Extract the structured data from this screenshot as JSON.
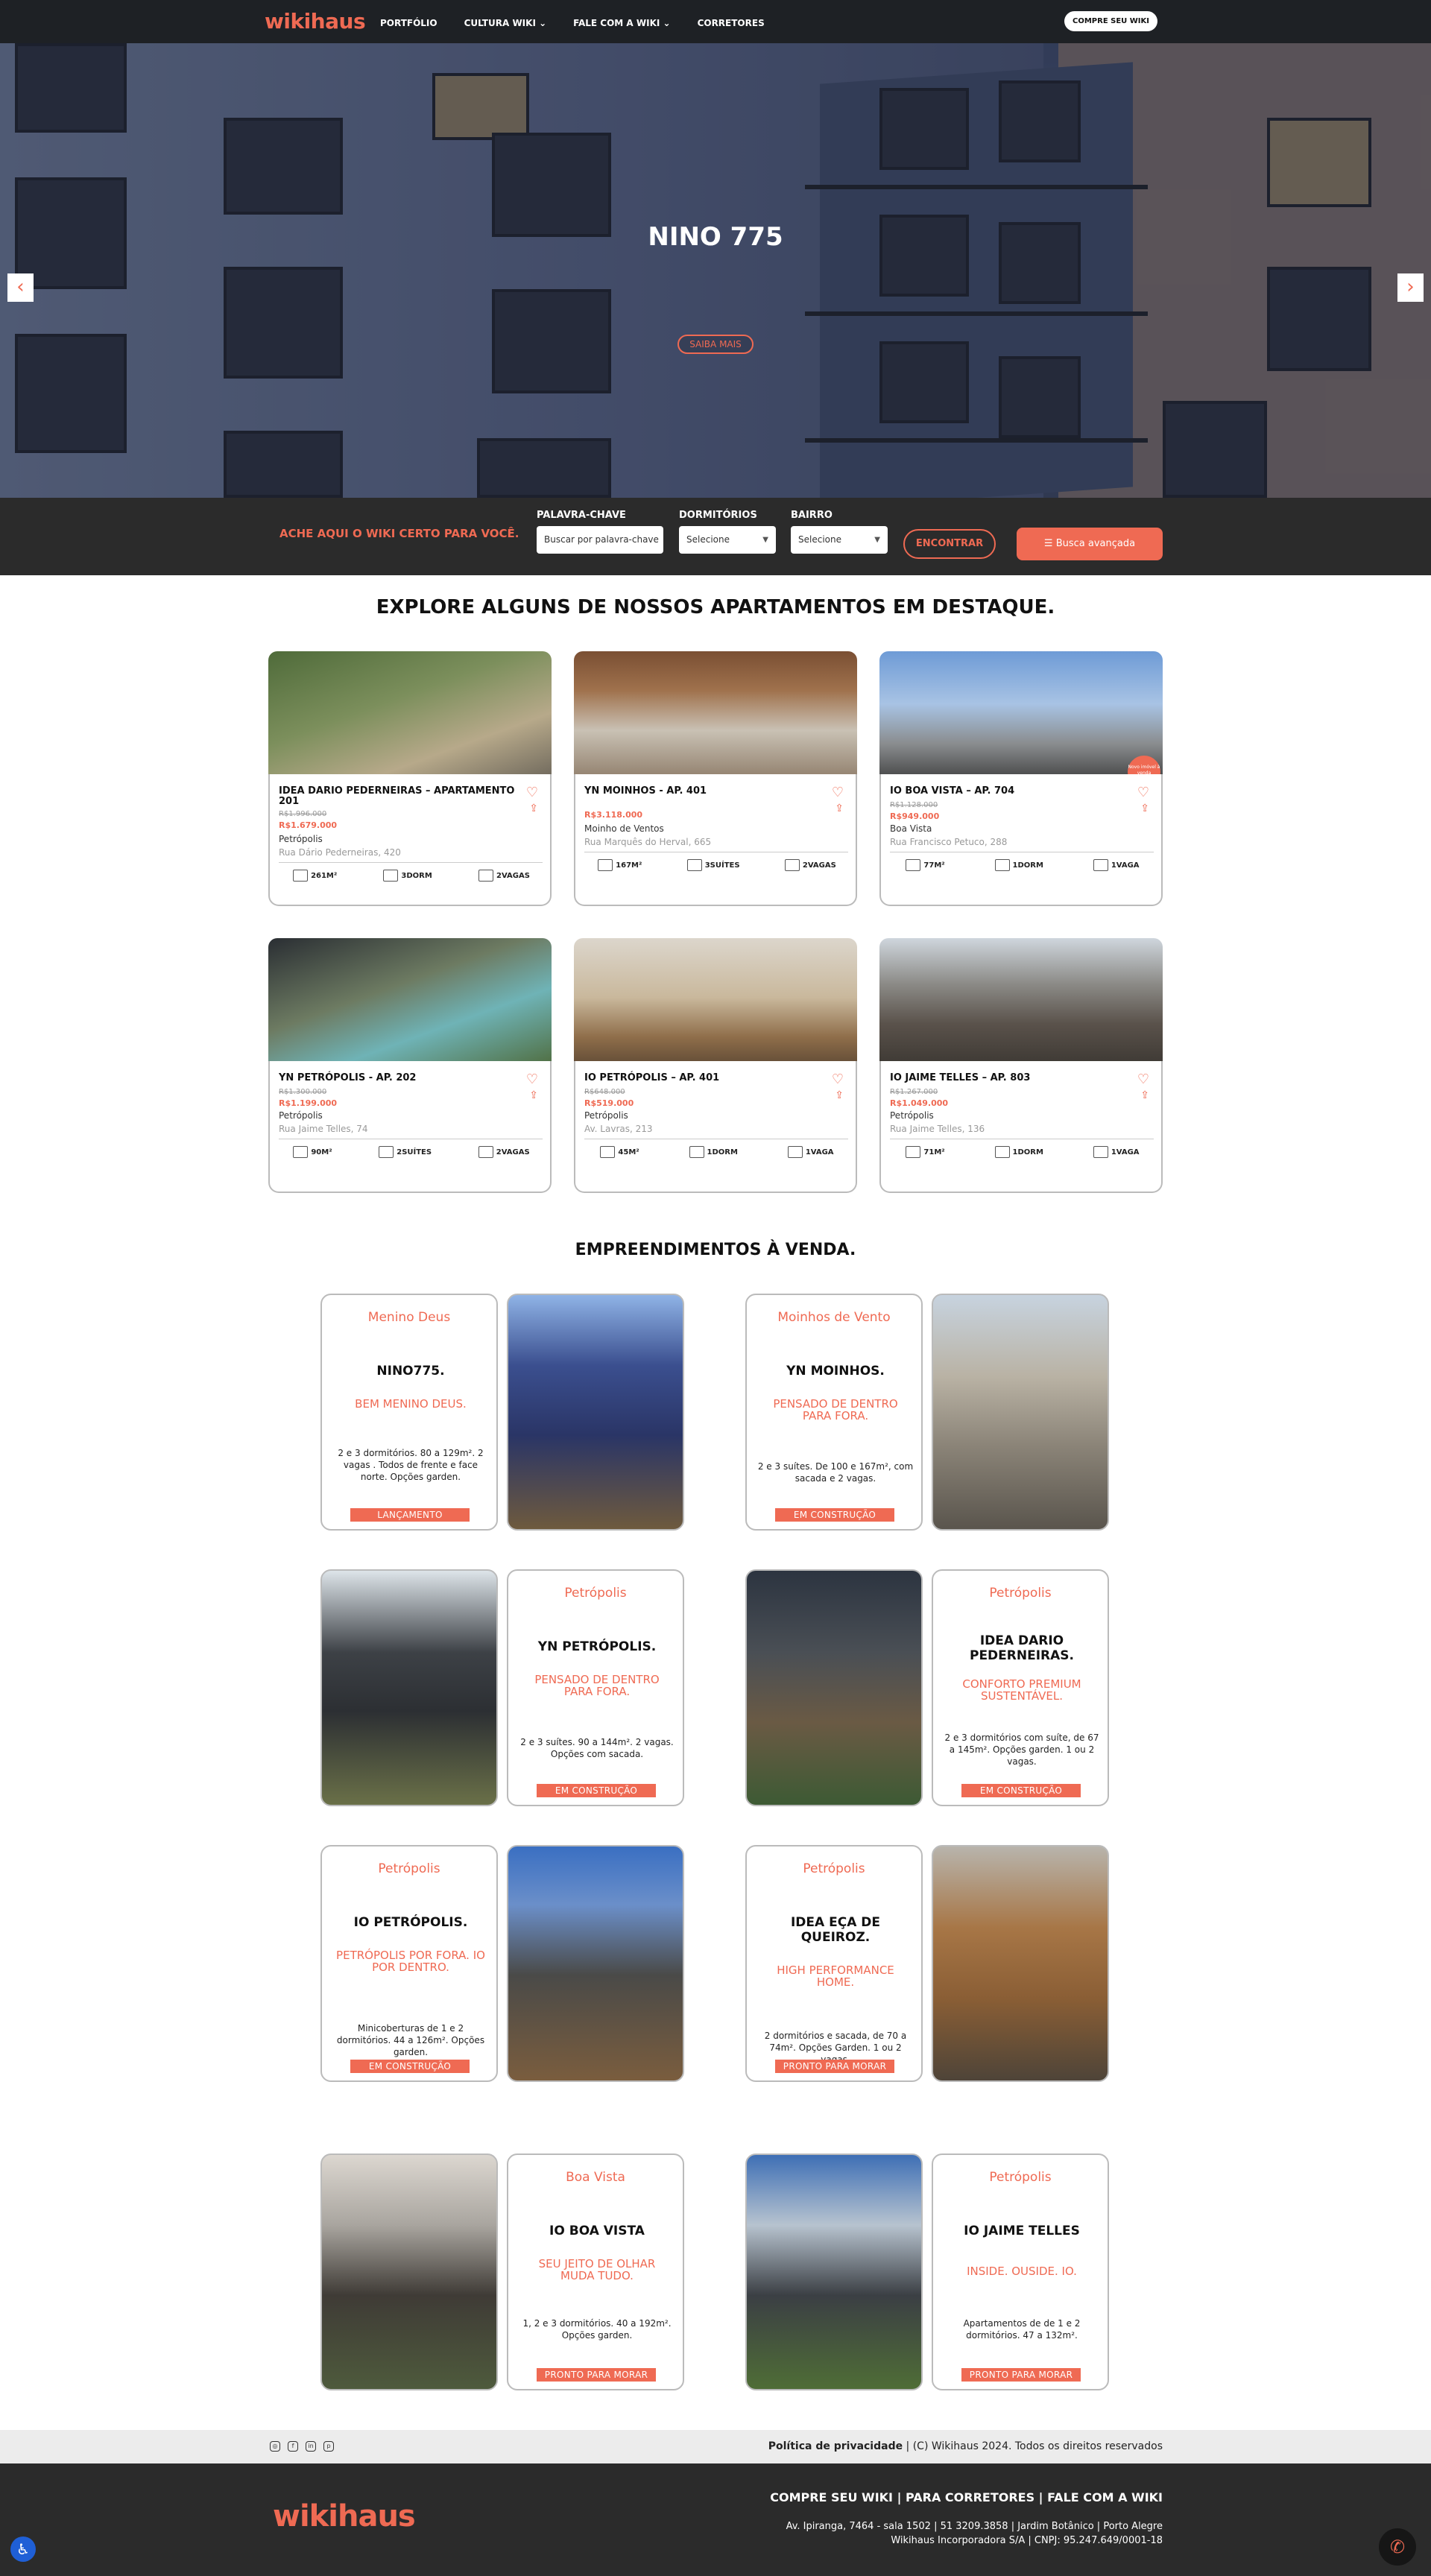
{
  "header": {
    "logo": "wikihaus",
    "nav": [
      "PORTFÓLIO",
      "CULTURA WIKI ⌄",
      "FALE COM A WIKI ⌄",
      "CORRETORES"
    ],
    "cta": "COMPRE SEU WIKI"
  },
  "hero": {
    "title": "NINO 775",
    "button": "SAIBA MAIS",
    "prev": "‹",
    "next": "›"
  },
  "search": {
    "tagline": "ACHE AQUI O WIKI CERTO PARA VOCÊ.",
    "keyword_label": "PALAVRA-CHAVE",
    "keyword_placeholder": "Buscar por palavra-chave",
    "dorm_label": "DORMITÓRIOS",
    "dorm_value": "Selecione",
    "bairro_label": "BAIRRO",
    "bairro_value": "Selecione",
    "find": "ENCONTRAR",
    "advanced": "Busca avançada"
  },
  "featured": {
    "title": "EXPLORE ALGUNS DE NOSSOS APARTAMENTOS EM DESTAQUE.",
    "badge": "Novo imóvel à venda",
    "cards": [
      {
        "title": "IDEA DARIO PEDERNEIRAS – APARTAMENTO 201",
        "old": "R$1.996.000",
        "new": "R$1.679.000",
        "bairro": "Petrópolis",
        "rua": "Rua Dário Pederneiras, 420",
        "area": "261M²",
        "rooms": "3DORM",
        "park": "2VAGAS"
      },
      {
        "title": "YN MOINHOS - AP. 401",
        "old": "",
        "new": "R$3.118.000",
        "bairro": "Moinho de Ventos",
        "rua": "Rua Marquês do Herval, 665",
        "area": "167M²",
        "rooms": "3SUÍTES",
        "park": "2VAGAS"
      },
      {
        "title": "IO BOA VISTA – AP. 704",
        "old": "R$1.128.000",
        "new": "R$949.000",
        "bairro": "Boa Vista",
        "rua": "Rua Francisco Petuco, 288",
        "area": "77M²",
        "rooms": "1DORM",
        "park": "1VAGA"
      },
      {
        "title": "YN PETRÓPOLIS - AP. 202",
        "old": "R$1.300.000",
        "new": "R$1.199.000",
        "bairro": "Petrópolis",
        "rua": "Rua Jaime Telles, 74",
        "area": "90M²",
        "rooms": "2SUÍTES",
        "park": "2VAGAS"
      },
      {
        "title": "IO PETRÓPOLIS – AP. 401",
        "old": "R$648.000",
        "new": "R$519.000",
        "bairro": "Petrópolis",
        "rua": "Av. Lavras, 213",
        "area": "45M²",
        "rooms": "1DORM",
        "park": "1VAGA"
      },
      {
        "title": "IO JAIME TELLES – AP. 803",
        "old": "R$1.267.000",
        "new": "R$1.049.000",
        "bairro": "Petrópolis",
        "rua": "Rua Jaime Telles, 136",
        "area": "71M²",
        "rooms": "1DORM",
        "park": "1VAGA"
      }
    ]
  },
  "dev": {
    "title": "EMPREENDIMENTOS À VENDA.",
    "items": [
      {
        "loc": "Menino Deus",
        "name": "NINO775.",
        "slogan": "BEM MENINO DEUS.",
        "desc": "2 e 3 dormitórios. 80 a 129m². 2 vagas . Todos de frente e face norte. Opções garden.",
        "status": "LANÇAMENTO"
      },
      {
        "loc": "Moinhos de Vento",
        "name": "YN MOINHOS.",
        "slogan": "PENSADO DE DENTRO PARA FORA.",
        "desc": "2 e 3 suítes. De 100 e 167m², com sacada e 2 vagas.",
        "status": "EM CONSTRUÇÃO"
      },
      {
        "loc": "Petrópolis",
        "name": "YN PETRÓPOLIS.",
        "slogan": "PENSADO DE DENTRO PARA FORA.",
        "desc": "2 e 3 suítes. 90 a 144m². 2 vagas. Opções com sacada.",
        "status": "EM CONSTRUÇÃO"
      },
      {
        "loc": "Petrópolis",
        "name": "IDEA DARIO PEDERNEIRAS.",
        "slogan": "CONFORTO PREMIUM SUSTENTÁVEL.",
        "desc": "2 e 3 dormitórios com suíte, de 67 a 145m². Opções garden. 1 ou 2 vagas.",
        "status": "EM CONSTRUÇÃO"
      },
      {
        "loc": "Petrópolis",
        "name": "IO PETRÓPOLIS.",
        "slogan": "PETRÓPOLIS POR FORA. IO POR DENTRO.",
        "desc": "Minicoberturas de 1 e 2 dormitórios. 44 a 126m². Opções garden.",
        "status": "EM CONSTRUÇÃO"
      },
      {
        "loc": "Petrópolis",
        "name": "IDEA EÇA DE QUEIROZ.",
        "slogan": "HIGH PERFORMANCE HOME.",
        "desc": "2 dormitórios e sacada, de 70 a 74m². Opções Garden. 1 ou 2 vagas.",
        "status": "PRONTO PARA MORAR"
      },
      {
        "loc": "Boa Vista",
        "name": "IO BOA VISTA",
        "slogan": "SEU JEITO DE OLHAR MUDA TUDO.",
        "desc": "1, 2 e 3 dormitórios. 40 a 192m². Opções garden.",
        "status": "PRONTO PARA MORAR"
      },
      {
        "loc": "Petrópolis",
        "name": "IO JAIME TELLES",
        "slogan": "INSIDE. OUSIDE. IO.",
        "desc": "Apartamentos de de 1 e 2 dormitórios. 47 a 132m².",
        "status": "PRONTO PARA MORAR"
      }
    ]
  },
  "footer": {
    "privacy": "Política de privacidade",
    "copyright": " | (C) Wikihaus 2024. Todos os direitos reservados",
    "logo": "wikihaus",
    "links": "COMPRE SEU WIKI  |  PARA CORRETORES  |  FALE COM A WIKI",
    "address1": "Av. Ipiranga, 7464 - sala 1502 | 51 3209.3858 | Jardim Botânico | Porto Alegre",
    "address2": "Wikihaus Incorporadora S/A | CNPJ: 95.247.649/0001-18"
  }
}
